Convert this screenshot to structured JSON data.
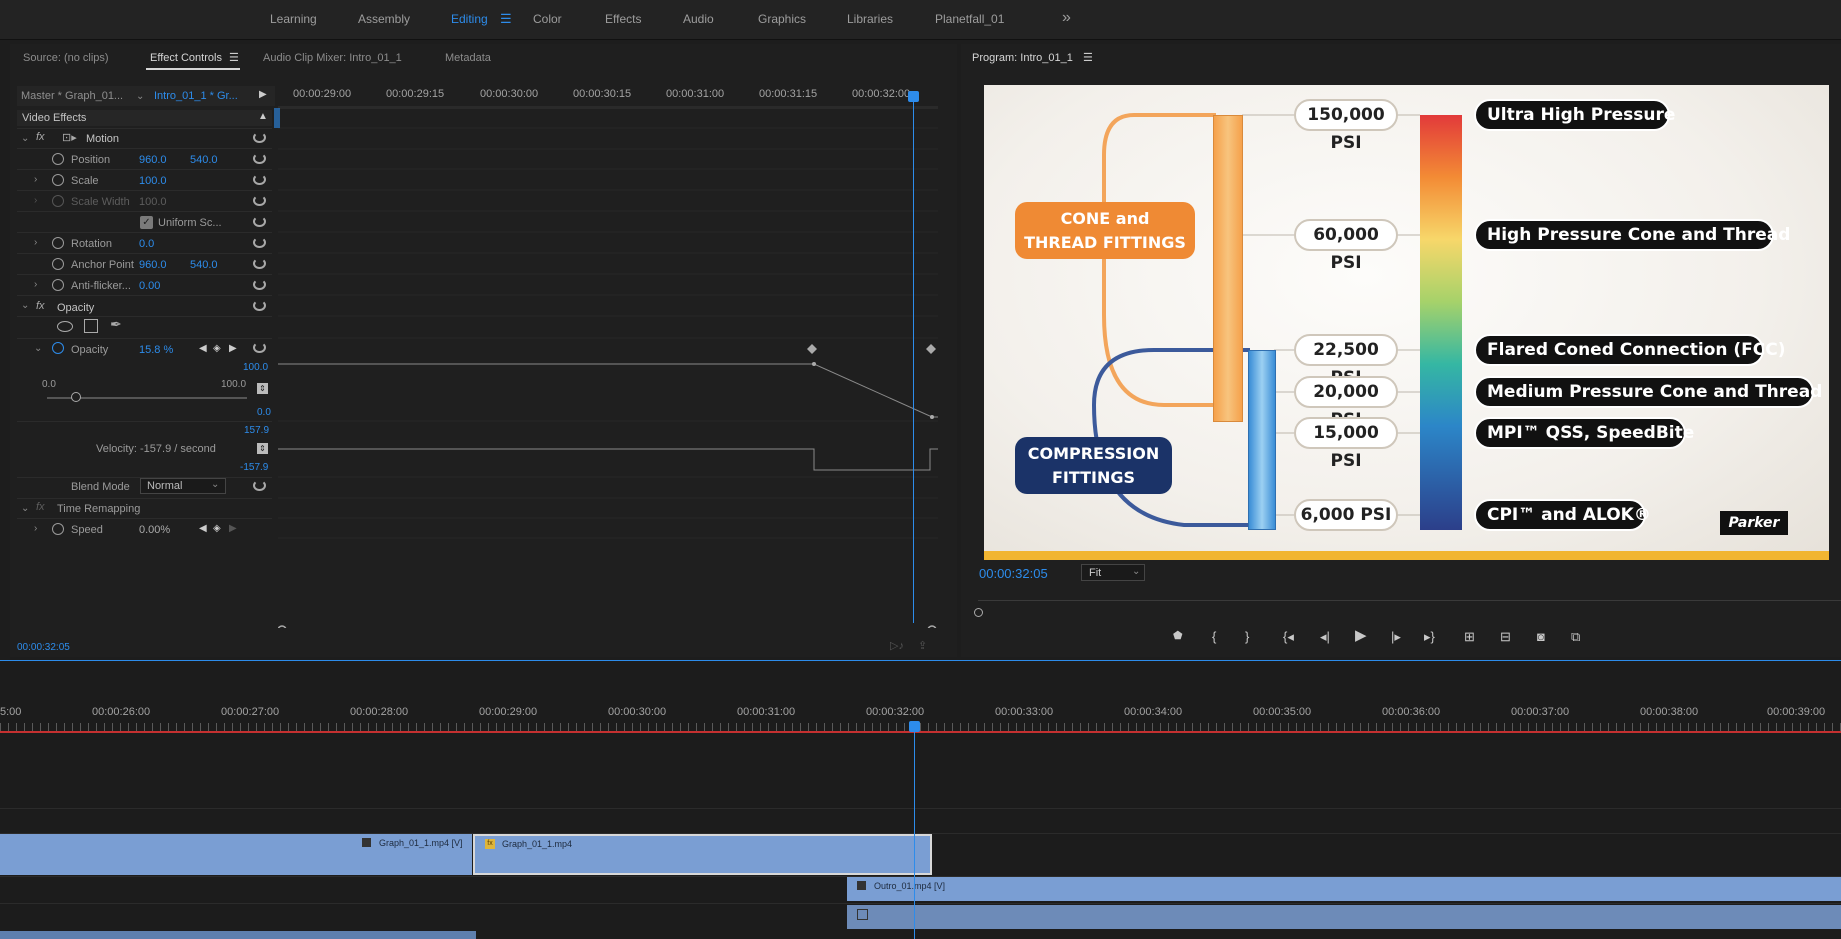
{
  "workspaces": [
    "Learning",
    "Assembly",
    "Editing",
    "Color",
    "Effects",
    "Audio",
    "Graphics",
    "Libraries",
    "Planetfall_01"
  ],
  "active_workspace": "Editing",
  "more_icon": "»",
  "left_panel": {
    "tabs": [
      "Source: (no clips)",
      "Effect Controls",
      "Audio Clip Mixer: Intro_01_1",
      "Metadata"
    ],
    "master": "Master * Graph_01...",
    "clip": "Intro_01_1 * Gr...",
    "ruler": [
      "00:00:29:00",
      "00:00:29:15",
      "00:00:30:00",
      "00:00:30:15",
      "00:00:31:00",
      "00:00:31:15",
      "00:00:32:00"
    ],
    "section": "Video Effects",
    "motion": "Motion",
    "props": {
      "position": "Position",
      "position_x": "960.0",
      "position_y": "540.0",
      "scale": "Scale",
      "scale_v": "100.0",
      "scale_width": "Scale Width",
      "scale_width_v": "100.0",
      "uniform": "Uniform Sc...",
      "rotation": "Rotation",
      "rotation_v": "0.0",
      "anchor": "Anchor Point",
      "anchor_x": "960.0",
      "anchor_y": "540.0",
      "antiflicker": "Anti-flicker...",
      "antiflicker_v": "0.00"
    },
    "opacity_section": "Opacity",
    "opacity_label": "Opacity",
    "opacity_value": "15.8 %",
    "slider_min": "0.0",
    "slider_max": "100.0",
    "graph_top": "100.0",
    "graph_bottom": "0.0",
    "vel_top": "157.9",
    "vel_bottom": "-157.9",
    "velocity": "Velocity: -157.9 / second",
    "blend_label": "Blend Mode",
    "blend_value": "Normal",
    "time_remap": "Time Remapping",
    "speed_label": "Speed",
    "speed_value": "0.00%",
    "timecode": "00:00:32:05"
  },
  "program": {
    "title": "Program: Intro_01_1",
    "timecode": "00:00:32:05",
    "fit": "Fit",
    "slide": {
      "cone": "CONE and THREAD FITTINGS",
      "compression": "COMPRESSION FITTINGS",
      "psi": [
        "150,000 PSI",
        "60,000 PSI",
        "22,500 PSI",
        "20,000 PSI",
        "15,000 PSI",
        "6,000 PSI"
      ],
      "labels": [
        "Ultra High Pressure",
        "High Pressure Cone and Thread",
        "Flared Coned Connection (FCC)",
        "Medium Pressure Cone and Thread",
        "MPI™ QSS, SpeedBite",
        "CPI™ and ALOK®"
      ],
      "logo": "Parker"
    },
    "controls": [
      "marker-icon",
      "mark-in-icon",
      "mark-out-icon",
      "go-to-in-icon",
      "step-back-icon",
      "play-icon",
      "step-forward-icon",
      "go-to-out-icon",
      "insert-icon",
      "overwrite-icon",
      "export-frame-icon",
      "button-editor-icon"
    ]
  },
  "timeline": {
    "ruler": [
      "5:00",
      "00:00:26:00",
      "00:00:27:00",
      "00:00:28:00",
      "00:00:29:00",
      "00:00:30:00",
      "00:00:31:00",
      "00:00:32:00",
      "00:00:33:00",
      "00:00:34:00",
      "00:00:35:00",
      "00:00:36:00",
      "00:00:37:00",
      "00:00:38:00",
      "00:00:39:00"
    ],
    "clips": [
      "Graph_01_1.mp4 [V]",
      "Graph_01_1.mp4",
      "Outro_01.mp4 [V]"
    ]
  },
  "colors": {
    "accent": "#2d8ceb",
    "orange": "#ef8a34",
    "navy": "#1b3368",
    "clip": "#7a9ed3"
  }
}
